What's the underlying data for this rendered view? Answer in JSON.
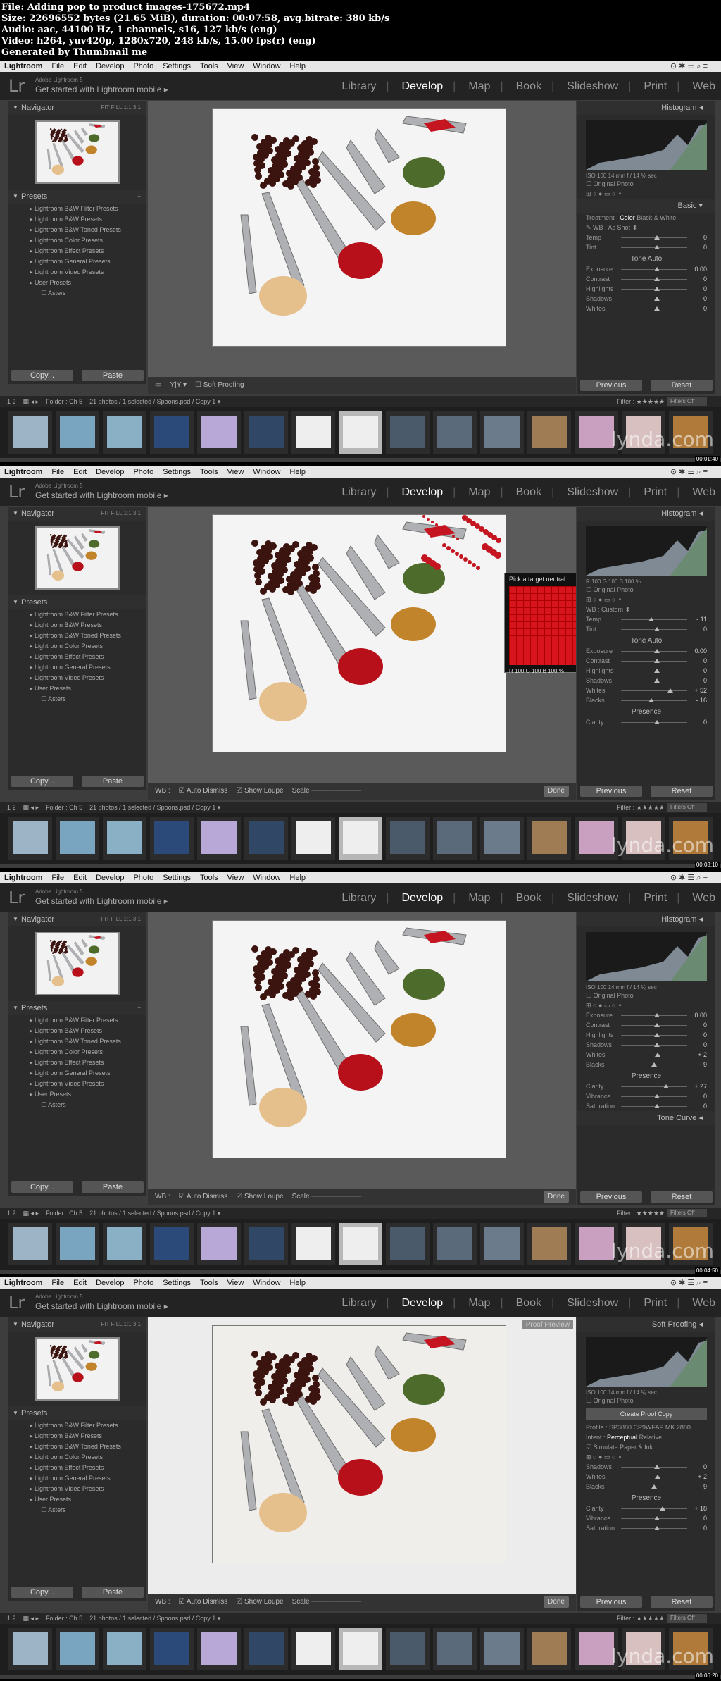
{
  "header": {
    "line1": "File: Adding pop to product images-175672.mp4",
    "line2": "Size: 22696552 bytes (21.65 MiB), duration: 00:07:58, avg.bitrate: 380 kb/s",
    "line3": "Audio: aac, 44100 Hz, 1 channels, s16, 127 kb/s (eng)",
    "line4": "Video: h264, yuv420p, 1280x720, 248 kb/s, 15.00 fps(r) (eng)",
    "line5": "Generated by Thumbnail me"
  },
  "menubar": {
    "app": "Lightroom",
    "items": [
      "File",
      "Edit",
      "Develop",
      "Photo",
      "Settings",
      "Tools",
      "View",
      "Window",
      "Help"
    ]
  },
  "identity": {
    "logo": "Lr",
    "subtitle": "Adobe Lightroom 5",
    "mobile": "Get started with Lightroom mobile ▸"
  },
  "modules": [
    "Library",
    "Develop",
    "Map",
    "Book",
    "Slideshow",
    "Print",
    "Web"
  ],
  "left_panel": {
    "navigator": "Navigator",
    "nav_zoom": "FIT  FILL  1:1  3:1",
    "presets": "Presets",
    "preset_items": [
      "Lightroom B&W Filter Presets",
      "Lightroom B&W Presets",
      "Lightroom B&W Toned Presets",
      "Lightroom Color Presets",
      "Lightroom Effect Presets",
      "Lightroom General Presets",
      "Lightroom Video Presets",
      "User Presets",
      "Asters"
    ],
    "copy": "Copy...",
    "paste": "Paste"
  },
  "right_panel": {
    "histogram": "Histogram",
    "soft_proofing": "Soft Proofing",
    "hist_meta": "ISO 100     14 mm     f / 14     ⅟₆ sec",
    "original_photo": "Original Photo",
    "basic": "Basic",
    "treatment": "Treatment :",
    "color": "Color",
    "bw": "Black & White",
    "wb": "WB :",
    "as_shot": "As Shot",
    "custom": "Custom",
    "temp": "Temp",
    "tint": "Tint",
    "tone": "Tone",
    "auto": "Auto",
    "exposure": "Exposure",
    "contrast": "Contrast",
    "highlights": "Highlights",
    "shadows": "Shadows",
    "whites": "Whites",
    "blacks": "Blacks",
    "presence": "Presence",
    "clarity": "Clarity",
    "vibrance": "Vibrance",
    "saturation": "Saturation",
    "tone_curve": "Tone Curve",
    "create_proof": "Create Proof Copy",
    "profile": "Profile :",
    "profile_val": "SP3880 CP9WFAP MK 2880...",
    "intent": "Intent :",
    "perceptual": "Perceptual",
    "relative": "Relative",
    "simulate": "Simulate Paper & Ink",
    "previous": "Previous",
    "reset": "Reset"
  },
  "toolbar": {
    "soft_proofing": "Soft Proofing",
    "wb": "WB :",
    "auto_dismiss": "Auto Dismiss",
    "show_loupe": "Show Loupe",
    "scale": "Scale",
    "done": "Done"
  },
  "filmstrip_bar": {
    "pages": "1  2",
    "folder": "Folder : Ch 5",
    "count": "21 photos / 1 selected / Spoons.psd / Copy 1 ▾",
    "filter": "Filter :",
    "filters_off": "Filters Off"
  },
  "picker": {
    "title": "Pick a target neutral:",
    "values": "R 100  G 100  B 100  %"
  },
  "hist_rgb": "R 100  G 100  B 100  %",
  "proof_preview": "Proof Preview",
  "watermark": "lynda.com",
  "frames": [
    {
      "timestamp": "00:01:40",
      "temp": "0",
      "tint": "0",
      "exposure": "0.00",
      "contrast": "0",
      "highlights": "0",
      "shadows": "0",
      "whites": "0"
    },
    {
      "timestamp": "00:03:10",
      "temp": "- 11",
      "tint": "0",
      "exposure": "0.00",
      "contrast": "0",
      "highlights": "0",
      "shadows": "0",
      "whites": "+ 52",
      "blacks": "- 16",
      "clarity": "0"
    },
    {
      "timestamp": "00:04:50",
      "exposure": "0.00",
      "contrast": "0",
      "highlights": "0",
      "shadows": "0",
      "whites": "+ 2",
      "blacks": "- 9",
      "clarity": "+ 27",
      "vibrance": "0",
      "saturation": "0"
    },
    {
      "timestamp": "00:06:20",
      "shadows": "0",
      "whites": "+ 2",
      "blacks": "- 9",
      "clarity": "+ 18",
      "vibrance": "0",
      "saturation": "0"
    }
  ],
  "colors": {
    "accent": "#ffffff",
    "red_spice": "#b8101b",
    "panel": "#2b2b2b"
  }
}
